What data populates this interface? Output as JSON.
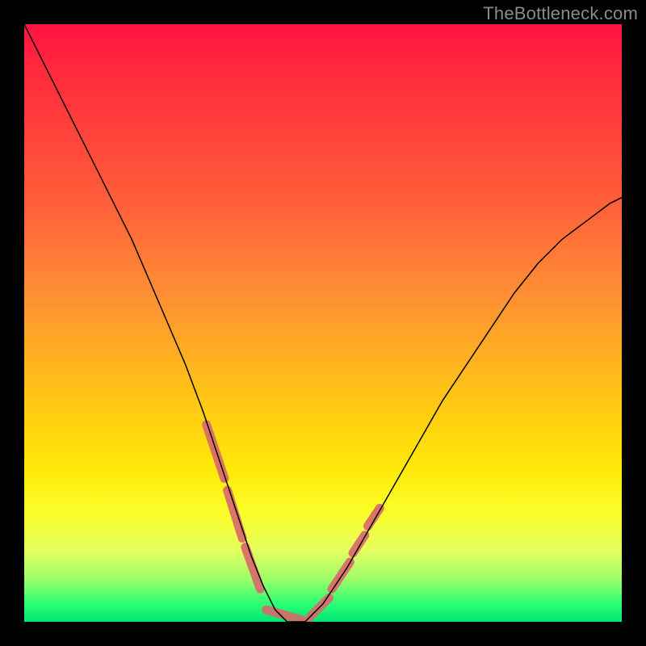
{
  "watermark": "TheBottleneck.com",
  "chart_data": {
    "type": "line",
    "title": "",
    "xlabel": "",
    "ylabel": "",
    "xlim": [
      0,
      100
    ],
    "ylim": [
      0,
      100
    ],
    "background_gradient": {
      "top": "#ff1440",
      "mid_upper": "#ff8e34",
      "mid_lower": "#ffe808",
      "bottom": "#00e574"
    },
    "series": [
      {
        "name": "bottleneck-curve",
        "color": "#000000",
        "width": 1.5,
        "x": [
          0,
          3,
          6,
          9,
          12,
          15,
          18,
          21,
          24,
          27,
          30,
          32,
          34,
          36,
          38,
          40,
          42,
          44,
          47,
          50,
          54,
          58,
          62,
          66,
          70,
          74,
          78,
          82,
          86,
          90,
          94,
          98,
          100
        ],
        "y": [
          100,
          94,
          88,
          82,
          76,
          70,
          64,
          57,
          50,
          43,
          35,
          29,
          23,
          17,
          11,
          6,
          2,
          0,
          0,
          3,
          9,
          16,
          23,
          30,
          37,
          43,
          49,
          55,
          60,
          64,
          67,
          70,
          71
        ]
      },
      {
        "name": "highlight-segments",
        "color": "#d86a6a",
        "width": 11,
        "linecap": "round",
        "segments": [
          {
            "x": [
              30.5,
              33.5
            ],
            "y": [
              33,
              24
            ]
          },
          {
            "x": [
              34.0,
              36.5
            ],
            "y": [
              22,
              14
            ]
          },
          {
            "x": [
              37.0,
              39.5
            ],
            "y": [
              12.5,
              5.5
            ]
          },
          {
            "x": [
              40.5,
              47.5
            ],
            "y": [
              2.0,
              0.0
            ]
          },
          {
            "x": [
              48.0,
              51.0
            ],
            "y": [
              1.0,
              4.0
            ]
          },
          {
            "x": [
              51.5,
              54.5
            ],
            "y": [
              5.5,
              10.0
            ]
          },
          {
            "x": [
              55.0,
              57.0
            ],
            "y": [
              11.5,
              14.5
            ]
          },
          {
            "x": [
              57.5,
              59.5
            ],
            "y": [
              16.0,
              19.0
            ]
          }
        ]
      }
    ]
  }
}
